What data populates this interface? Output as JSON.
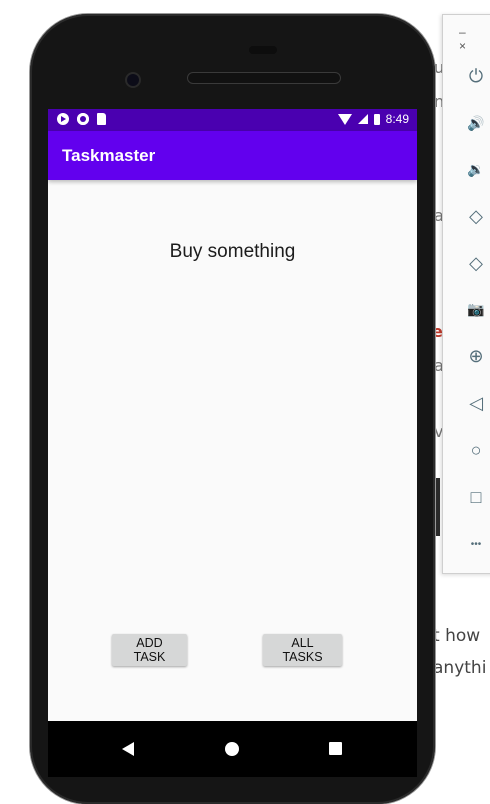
{
  "status_bar": {
    "time": "8:49"
  },
  "app": {
    "title": "Taskmaster"
  },
  "task": {
    "title": "Buy something"
  },
  "buttons": {
    "add_task": "ADD TASK",
    "all_tasks": "ALL TASKS"
  },
  "emulator": {
    "window_controls": [
      "–",
      "×"
    ],
    "tools": [
      {
        "name": "power",
        "glyph": "⏻"
      },
      {
        "name": "volume-up",
        "glyph": "🔊"
      },
      {
        "name": "volume-down",
        "glyph": "🔉"
      },
      {
        "name": "rotate-left",
        "glyph": "◇"
      },
      {
        "name": "rotate-right",
        "glyph": "◇"
      },
      {
        "name": "screenshot",
        "glyph": "📷"
      },
      {
        "name": "zoom",
        "glyph": "⊕"
      },
      {
        "name": "back",
        "glyph": "◁"
      },
      {
        "name": "home",
        "glyph": "○"
      },
      {
        "name": "overview",
        "glyph": "□"
      },
      {
        "name": "more",
        "glyph": "•••"
      }
    ]
  },
  "background_text": {
    "frag1": "us",
    "frag2": "n",
    "frag3": "a",
    "frag4": "er",
    "frag5": "a",
    "frag6": "v",
    "line1": "t how",
    "line2": "anythi"
  },
  "colors": {
    "status_bar": "#4a00b0",
    "app_bar": "#6200ee",
    "screen_bg": "#fafafa",
    "button_bg": "#d6d7d7"
  }
}
